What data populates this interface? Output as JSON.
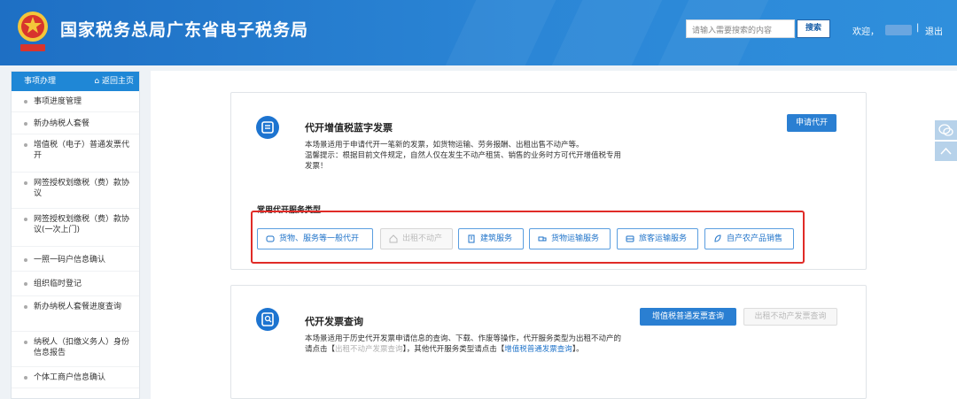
{
  "header": {
    "title": "国家税务总局广东省电子税务局",
    "search_placeholder": "请输入需要搜索的内容",
    "search_button": "搜索",
    "welcome": "欢迎，",
    "separator": "|",
    "logout": "退出"
  },
  "sidebar": {
    "title": "事项办理",
    "back": "返回主页",
    "items": [
      {
        "label": "事项进度管理"
      },
      {
        "label": "新办纳税人套餐"
      },
      {
        "label": "增值税（电子）普通发票代开"
      },
      {
        "label": "网签授权划缴税（费）款协议"
      },
      {
        "label": "网签授权划缴税（费）款协议(一次上门)"
      },
      {
        "label": "一照一码户信息确认"
      },
      {
        "label": "组织临时登记"
      },
      {
        "label": "新办纳税人套餐进度查询"
      },
      {
        "label": "纳税人（扣缴义务人）身份信息报告"
      },
      {
        "label": "个体工商户信息确认"
      }
    ]
  },
  "card1": {
    "title": "代开增值税蓝字发票",
    "desc": "本场景适用于申请代开一笔新的发票，如货物运输、劳务报酬、出租出售不动产等。",
    "tip_line1": "温馨提示：根据目前文件规定，自然人仅在发生不动产租赁、销售的业务时方可代开增值税专用",
    "tip_line2": "发票！",
    "apply_button": "申请代开",
    "section_label": "常用代开服务类型",
    "services": [
      {
        "label": "货物、服务等一般代开",
        "icon": "cube-icon",
        "enabled": true
      },
      {
        "label": "出租不动产",
        "icon": "house-icon",
        "enabled": false
      },
      {
        "label": "建筑服务",
        "icon": "building-icon",
        "enabled": true
      },
      {
        "label": "货物运输服务",
        "icon": "truck-icon",
        "enabled": true
      },
      {
        "label": "旅客运输服务",
        "icon": "bus-icon",
        "enabled": true
      },
      {
        "label": "自产农产品销售",
        "icon": "leaf-icon",
        "enabled": true
      }
    ]
  },
  "card2": {
    "title": "代开发票查询",
    "query_vat_button": "增值税普通发票查询",
    "query_rent_button": "出租不动产发票查询",
    "desc_line1": "本场景适用于历史代开发票申请信息的查询、下载、作废等操作，代开服务类型为出租不动产的",
    "desc_line2_a": "请点击【",
    "desc_line2_link1": "出租不动产发票查询",
    "desc_line2_b": "】，其他代开服务类型请点击【",
    "desc_line2_link2": "增值税普通发票查询",
    "desc_line2_c": "】。"
  },
  "colors": {
    "header_blue": "#1e6fc4",
    "primary": "#2a7fd2",
    "highlight_red": "#e02b27"
  }
}
